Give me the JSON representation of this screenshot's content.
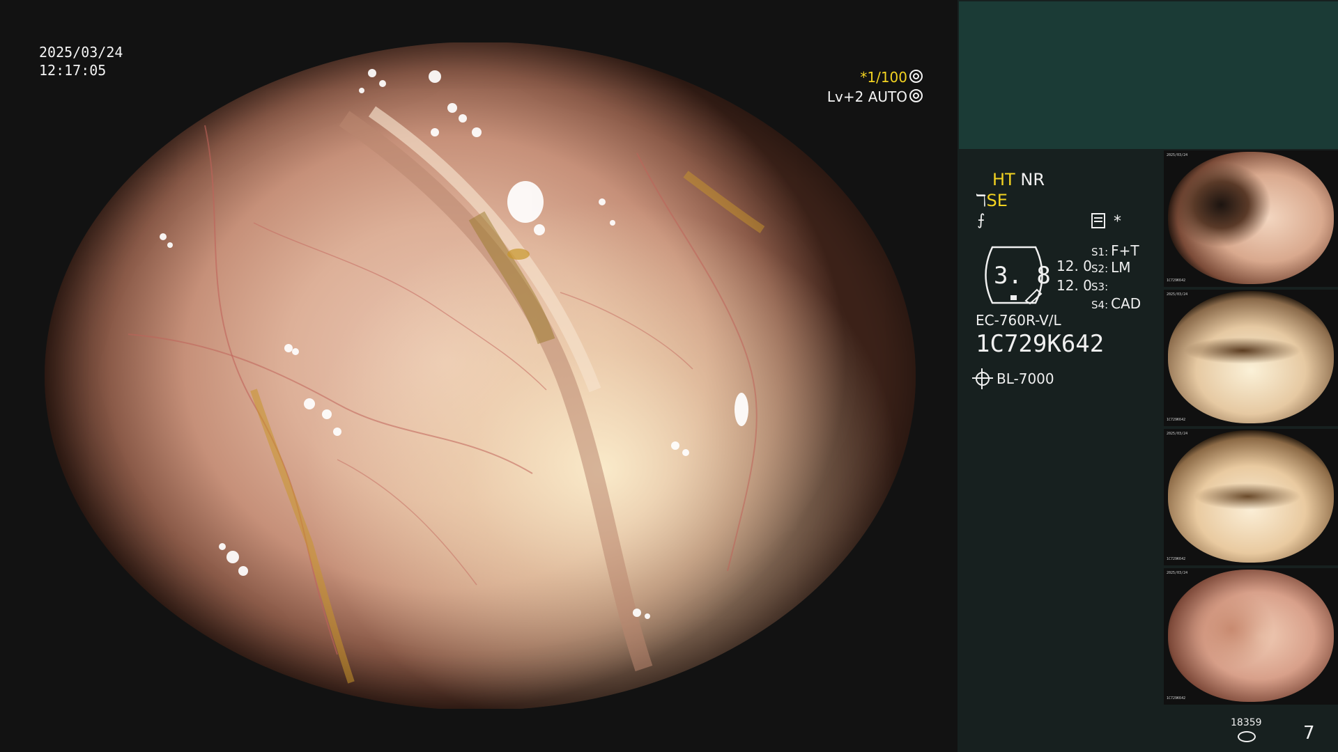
{
  "overlay": {
    "date": "2025/03/24",
    "time": "12:17:05",
    "shutter_prefix": "*",
    "shutter_value": "1/100",
    "shutter_icon": "aperture-icon",
    "level": "Lv+2",
    "mode": "AUTO",
    "mode_icon": "auto-iris-icon"
  },
  "panel": {
    "ht": "HT",
    "nr": "NR",
    "se": "SE",
    "se_icon": "enhance-icon",
    "f_icon": "freeze-icon",
    "menu_icon": "menu-icon",
    "star": "*",
    "gauge_value": "3. 8",
    "gauge_v1": "12. 0",
    "gauge_v2": "12. 0",
    "s1_key": "S1:",
    "s1_val": "F+T",
    "s2_key": "S2:",
    "s2_val": "LM",
    "s3_key": "S3:",
    "s3_val": "",
    "s4_key": "S4:",
    "s4_val": "CAD",
    "scope_model": "EC-760R-V/L",
    "scope_serial": "1C729K642",
    "light_source": "BL-7000",
    "light_icon": "sun-icon"
  },
  "thumbnails": [
    {
      "date": "2025/03/24",
      "serial": "1C729K642"
    },
    {
      "date": "2025/03/24",
      "serial": "1C729K642"
    },
    {
      "date": "2025/03/24",
      "serial": "1C729K642"
    },
    {
      "date": "2025/03/24",
      "serial": "1C729K642"
    }
  ],
  "footer": {
    "counter": "18359",
    "counter_icon": "disk-icon",
    "page": "7"
  },
  "colors": {
    "accent_yellow": "#f3d321",
    "panel_bg": "#17201f",
    "top_box_bg": "#1b3b36"
  }
}
